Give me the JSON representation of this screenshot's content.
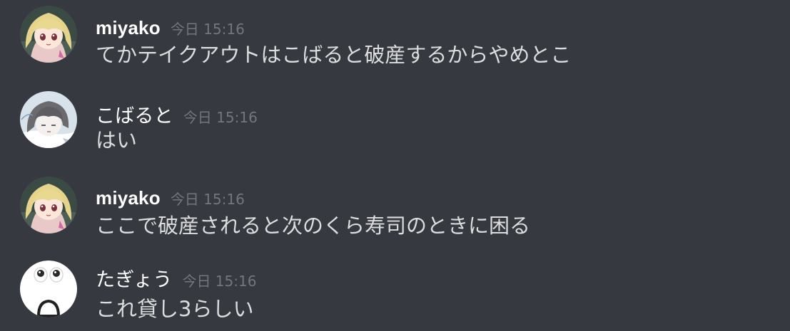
{
  "messages": [
    {
      "author": "miyako",
      "timestamp": "今日 15:16",
      "text": "てかテイクアウトはこばると破産するからやめとこ",
      "avatar_icon": "anime-girl-avatar"
    },
    {
      "author": "こばると",
      "timestamp": "今日 15:16",
      "text": "はい",
      "avatar_icon": "grey-hair-sketch-avatar"
    },
    {
      "author": "miyako",
      "timestamp": "今日 15:16",
      "text": "ここで破産されると次のくら寿司のときに困る",
      "avatar_icon": "anime-girl-avatar"
    },
    {
      "author": "たぎょう",
      "timestamp": "今日 15:16",
      "text": "これ貸し3らしい",
      "avatar_icon": "shocked-face-avatar"
    }
  ],
  "colors": {
    "background": "#36393f",
    "username": "#ffffff",
    "timestamp": "#72767d",
    "message_text": "#dcddde"
  }
}
